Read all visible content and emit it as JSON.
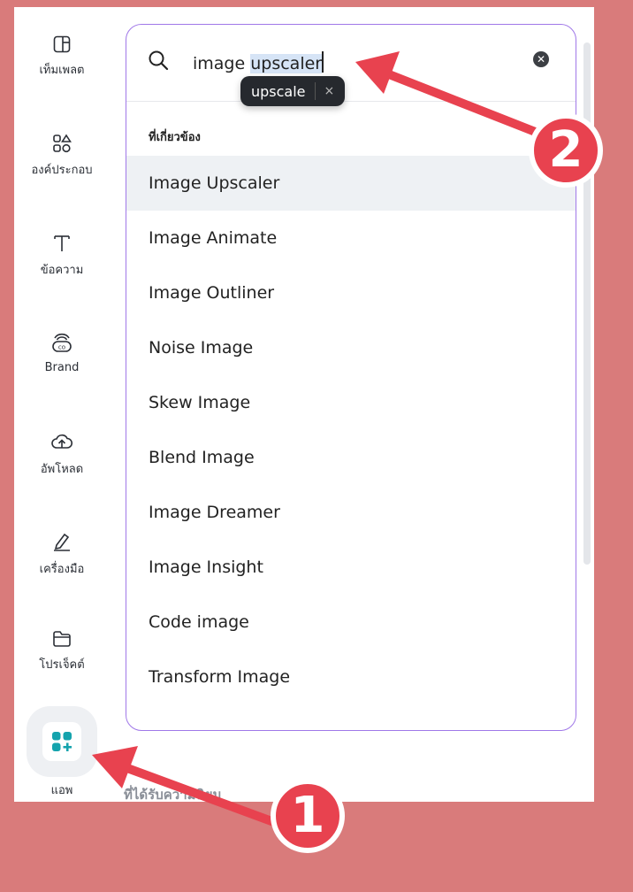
{
  "sidebar": {
    "items": [
      {
        "icon": "template-icon",
        "label": "เท็มเพลต"
      },
      {
        "icon": "elements-icon",
        "label": "องค์ประกอบ"
      },
      {
        "icon": "text-icon",
        "label": "ข้อความ"
      },
      {
        "icon": "brand-icon",
        "label": "Brand"
      },
      {
        "icon": "upload-icon",
        "label": "อัพโหลด"
      },
      {
        "icon": "draw-icon",
        "label": "เครื่องมือ"
      },
      {
        "icon": "folder-icon",
        "label": "โปรเจ็คต์"
      },
      {
        "icon": "apps-icon",
        "label": "แอพ"
      }
    ]
  },
  "search": {
    "query_prefix": "image ",
    "query_selected": "upscaler",
    "autocomplete_pill": "upscale",
    "pill_close": "×",
    "clear_icon": "clear-icon"
  },
  "results": {
    "heading": "ที่เกี่ยวข้อง",
    "items": [
      "Image Upscaler",
      "Image Animate",
      "Image Outliner",
      "Noise Image",
      "Skew Image",
      "Blend Image",
      "Image Dreamer",
      "Image Insight",
      "Code image",
      "Transform Image"
    ],
    "highlighted_index": 0
  },
  "background_section_title": "ที่ได้รับความนิยม",
  "annotations": {
    "badge_1": "1",
    "badge_2": "2",
    "color": "#e8424f"
  },
  "colors": {
    "page_bg": "#d97b7b",
    "panel_border": "#a078e8",
    "apps_icon": "#14a3ad"
  }
}
